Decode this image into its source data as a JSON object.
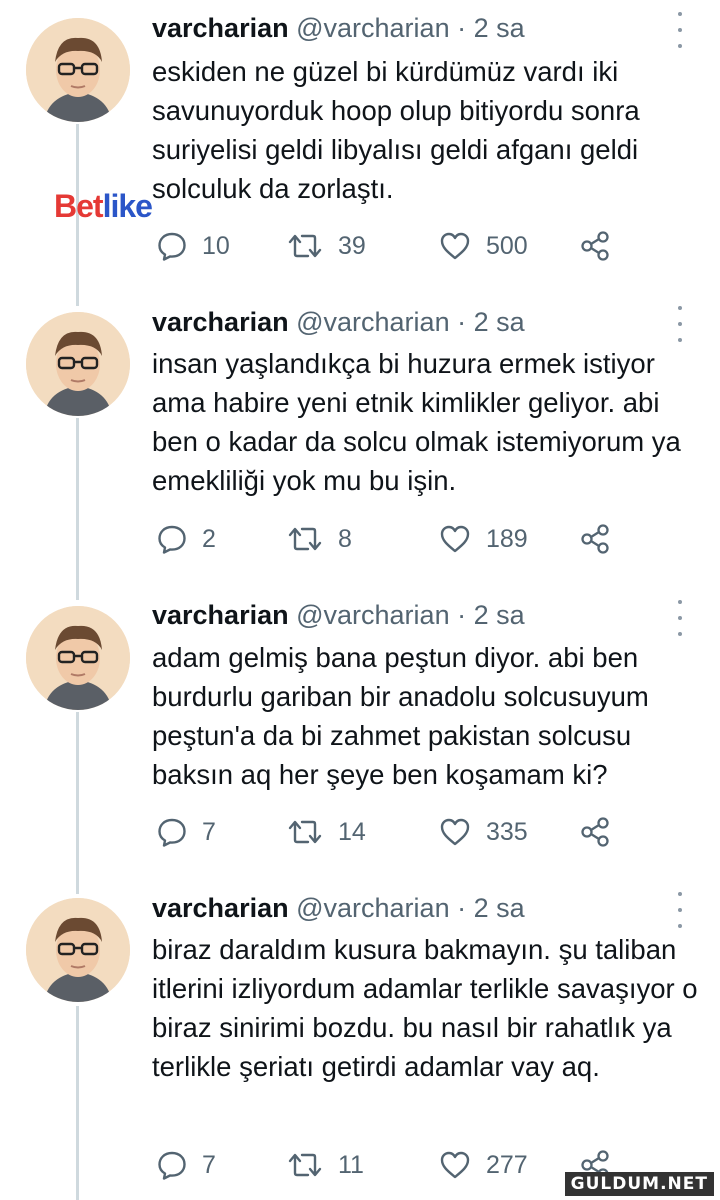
{
  "watermark": {
    "brand_prefix": "Bet",
    "brand_suffix": "like"
  },
  "site_logo": "GULDUM.NET",
  "tweets": [
    {
      "name": "varcharian",
      "handle": "@varcharian",
      "time": "· 2 sa",
      "text": "eskiden ne güzel bi kürdümüz vardı iki savunuyorduk hoop olup bitiyordu sonra suriyelisi geldi libyalısı geldi afganı geldi solculuk da zorlaştı.",
      "replies": "10",
      "retweets": "39",
      "likes": "500"
    },
    {
      "name": "varcharian",
      "handle": "@varcharian",
      "time": "· 2 sa",
      "text": "insan yaşlandıkça bi huzura ermek istiyor ama habire yeni etnik kimlikler geliyor. abi ben o kadar da solcu olmak istemiyorum ya emekliliği yok mu bu işin.",
      "replies": "2",
      "retweets": "8",
      "likes": "189"
    },
    {
      "name": "varcharian",
      "handle": "@varcharian",
      "time": "· 2 sa",
      "text": "adam gelmiş bana peştun diyor. abi ben burdurlu gariban bir anadolu solcusuyum peştun'a da bi zahmet pakistan solcusu baksın aq her şeye ben koşamam ki?",
      "replies": "7",
      "retweets": "14",
      "likes": "335"
    },
    {
      "name": "varcharian",
      "handle": "@varcharian",
      "time": "· 2 sa",
      "text": "biraz daraldım kusura bakmayın. şu taliban itlerini izliyordum adamlar terlikle savaşıyor o biraz sinirimi bozdu. bu nasıl bir rahatlık ya terlikle şeriatı getirdi adamlar vay aq.",
      "replies": "7",
      "retweets": "11",
      "likes": "277"
    }
  ]
}
